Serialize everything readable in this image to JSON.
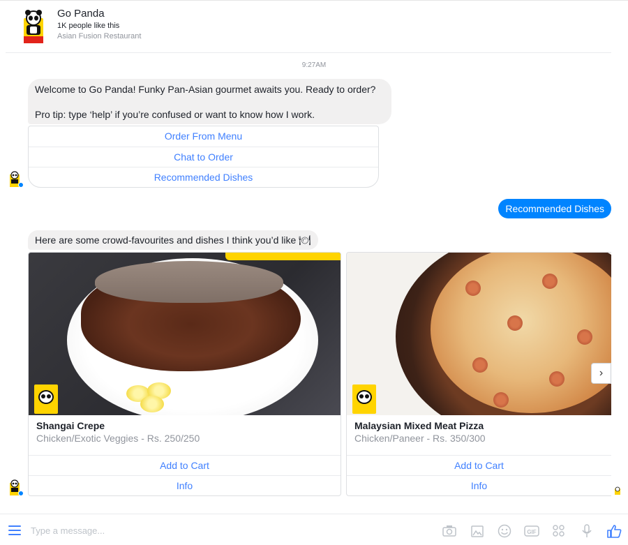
{
  "header": {
    "name": "Go Panda",
    "likes": "1K people like this",
    "category": "Asian Fusion Restaurant"
  },
  "timestamp": "9:27AM",
  "welcome": {
    "line1": "Welcome to Go Panda! Funky Pan-Asian gourmet awaits you. Ready to order?",
    "line2": "Pro tip: type ‘help’ if you’re confused or want to know how I work.",
    "buttons": [
      "Order From Menu",
      "Chat to Order",
      "Recommended Dishes"
    ]
  },
  "user_message": "Recommended Dishes",
  "crowd_message": "Here are some crowd-favourites and dishes I think you’d like 🍽",
  "cards": [
    {
      "title": "Shangai Crepe",
      "subtitle": "Chicken/Exotic Veggies - Rs. 250/250",
      "btn1": "Add to Cart",
      "btn2": "Info"
    },
    {
      "title": "Malaysian Mixed Meat Pizza",
      "subtitle": "Chicken/Paneer - Rs. 350/300",
      "btn1": "Add to Cart",
      "btn2": "Info"
    }
  ],
  "next_arrow": "›",
  "composer": {
    "placeholder": "Type a message...",
    "icons": [
      "menu-icon",
      "camera-icon",
      "image-icon",
      "smiley-icon",
      "gif-icon",
      "apps-icon",
      "microphone-icon",
      "thumbs-up-icon"
    ]
  },
  "colors": {
    "accent": "#0084ff",
    "link": "#4080ff",
    "bubble_gray": "#f1f0f0",
    "brand_yellow": "#ffd400"
  }
}
